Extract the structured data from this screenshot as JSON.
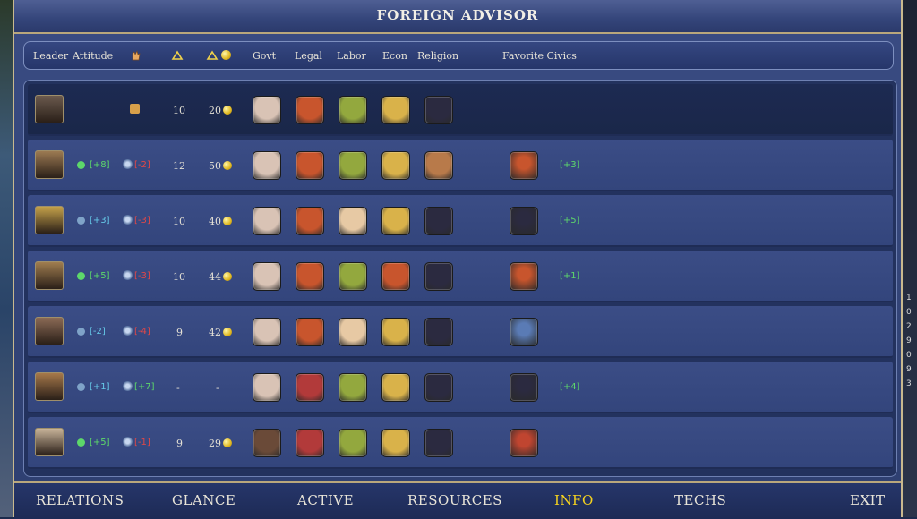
{
  "title": "FOREIGN ADVISOR",
  "headers": {
    "leader": "Leader",
    "attitude": "Attitude",
    "govt": "Govt",
    "legal": "Legal",
    "labor": "Labor",
    "econ": "Econ",
    "religion": "Religion",
    "favorite": "Favorite Civics"
  },
  "rows": [
    {
      "att_val": "",
      "att_color": "",
      "att2_val": "",
      "att2_color": "",
      "n1": "10",
      "n2": "20",
      "coin": true,
      "civics": [
        "#d9c3b5",
        "#c8552d",
        "#93a83e",
        "#d9b24a",
        "#2b2a40"
      ],
      "fav": "",
      "fav_val": ""
    },
    {
      "att_val": "[+8]",
      "att_color": "green",
      "att2_val": "[-2]",
      "att2_color": "red",
      "n1": "12",
      "n2": "50",
      "coin": true,
      "civics": [
        "#d9c3b5",
        "#c8552d",
        "#93a83e",
        "#d9b24a",
        "#b87a4a"
      ],
      "fav": "#c8552d",
      "fav_val": "[+3]"
    },
    {
      "att_val": "[+3]",
      "att_color": "cyan",
      "att2_val": "[-3]",
      "att2_color": "red",
      "n1": "10",
      "n2": "40",
      "coin": true,
      "civics": [
        "#d9c3b5",
        "#c8552d",
        "#e7c9a4",
        "#d9b24a",
        "#2b2a40"
      ],
      "fav": "#2b2a40",
      "fav_val": "[+5]"
    },
    {
      "att_val": "[+5]",
      "att_color": "green",
      "att2_val": "[-3]",
      "att2_color": "red",
      "n1": "10",
      "n2": "44",
      "coin": true,
      "civics": [
        "#d9c3b5",
        "#c8552d",
        "#93a83e",
        "#c8552d",
        "#2b2a40"
      ],
      "fav": "#c8552d",
      "fav_val": "[+1]"
    },
    {
      "att_val": "[-2]",
      "att_color": "cyan",
      "att2_val": "[-4]",
      "att2_color": "red",
      "n1": "9",
      "n2": "42",
      "coin": true,
      "civics": [
        "#d9c3b5",
        "#c8552d",
        "#e7c9a4",
        "#d9b24a",
        "#2b2a40"
      ],
      "fav": "#5a7bb5",
      "fav_val": ""
    },
    {
      "att_val": "[+1]",
      "att_color": "cyan",
      "att2_val": "[+7]",
      "att2_color": "green",
      "n1": "-",
      "n2": "-",
      "coin": false,
      "civics": [
        "#d9c3b5",
        "#b23a3a",
        "#93a83e",
        "#d9b24a",
        "#2b2a40"
      ],
      "fav": "#2b2a40",
      "fav_val": "[+4]"
    },
    {
      "att_val": "[+5]",
      "att_color": "green",
      "att2_val": "[-1]",
      "att2_color": "red",
      "n1": "9",
      "n2": "29",
      "coin": true,
      "civics": [
        "#6a4a38",
        "#b23a3a",
        "#93a83e",
        "#d9b24a",
        "#2b2a40"
      ],
      "fav": "#c04530",
      "fav_val": ""
    }
  ],
  "portraits": [
    "#6b5a4e",
    "#9c7a52",
    "#c6a24a",
    "#a07d4f",
    "#8b6a55",
    "#a6784a",
    "#c9b59a"
  ],
  "tabs": {
    "relations": "RELATIONS",
    "glance": "GLANCE",
    "active": "ACTIVE",
    "resources": "RESOURCES",
    "info": "INFO",
    "techs": "TECHS",
    "exit": "EXIT"
  },
  "colors": {
    "active_tab": "#f5d21e",
    "green": "#5dd86a",
    "cyan": "#66c9e8",
    "red": "#e04848"
  },
  "sidebar_numbers": [
    "1",
    "0",
    "2",
    "9",
    "0",
    "9",
    "3"
  ]
}
